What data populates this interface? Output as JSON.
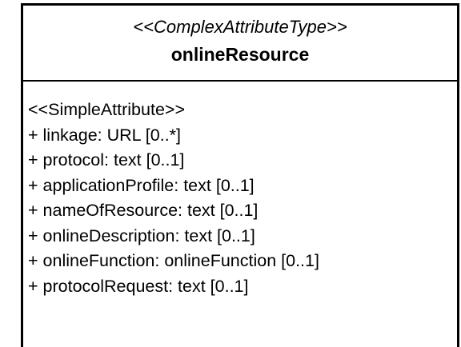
{
  "uml_class": {
    "stereotype": "<<ComplexAttributeType>>",
    "name": "onlineResource",
    "attribute_stereotype": "<<SimpleAttribute>>",
    "attributes": [
      "+ linkage: URL [0..*]",
      "+ protocol: text [0..1]",
      "+ applicationProfile: text [0..1]",
      "+ nameOfResource: text [0..1]",
      "+ onlineDescription: text [0..1]",
      "+ onlineFunction: onlineFunction [0..1]",
      "+ protocolRequest: text [0..1]"
    ]
  }
}
